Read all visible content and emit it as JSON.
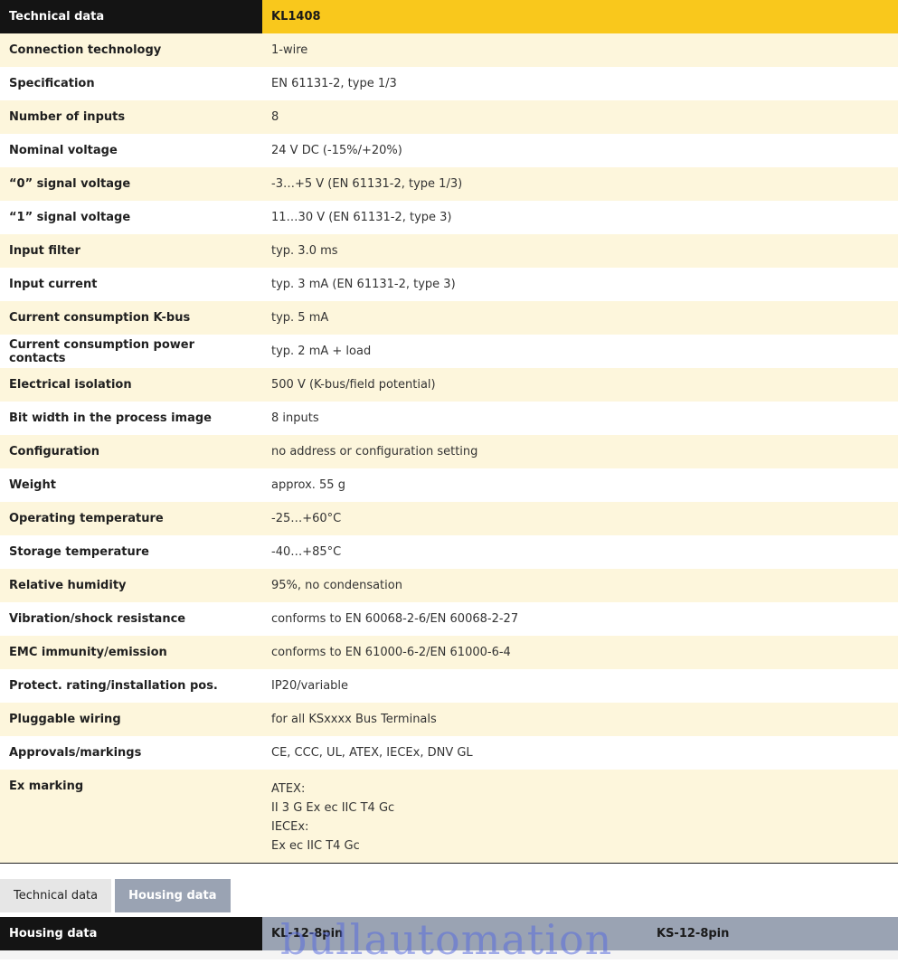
{
  "table": {
    "header_left": "Technical data",
    "header_right": "KL1408",
    "rows": [
      {
        "k": "Connection technology",
        "v": "1-wire"
      },
      {
        "k": "Specification",
        "v": "EN 61131-2, type 1/3"
      },
      {
        "k": "Number of inputs",
        "v": "8"
      },
      {
        "k": "Nominal voltage",
        "v": "24 V DC (-15%/+20%)"
      },
      {
        "k": "“0” signal voltage",
        "v": "-3…+5 V (EN 61131-2, type 1/3)"
      },
      {
        "k": "“1” signal voltage",
        "v": "11…30 V (EN 61131-2, type 3)"
      },
      {
        "k": "Input filter",
        "v": "typ. 3.0 ms"
      },
      {
        "k": "Input current",
        "v": "typ. 3 mA (EN 61131-2, type 3)"
      },
      {
        "k": "Current consumption K-bus",
        "v": "typ. 5 mA"
      },
      {
        "k": "Current consumption power contacts",
        "v": "typ. 2 mA + load"
      },
      {
        "k": "Electrical isolation",
        "v": "500 V (K-bus/field potential)"
      },
      {
        "k": "Bit width in the process image",
        "v": "8 inputs"
      },
      {
        "k": "Configuration",
        "v": "no address or configuration setting"
      },
      {
        "k": "Weight",
        "v": "approx. 55 g"
      },
      {
        "k": "Operating temperature",
        "v": "-25…+60°C"
      },
      {
        "k": "Storage temperature",
        "v": "-40…+85°C"
      },
      {
        "k": "Relative humidity",
        "v": "95%, no condensation"
      },
      {
        "k": "Vibration/shock resistance",
        "v": "conforms to EN 60068-2-6/EN 60068-2-27"
      },
      {
        "k": "EMC immunity/emission",
        "v": "conforms to EN 61000-6-2/EN 61000-6-4"
      },
      {
        "k": "Protect. rating/installation pos.",
        "v": "IP20/variable"
      },
      {
        "k": "Pluggable wiring",
        "v": "for all KSxxxx Bus Terminals"
      },
      {
        "k": "Approvals/markings",
        "v": "CE, CCC, UL, ATEX, IECEx, DNV GL"
      }
    ],
    "ex_marking": {
      "k": "Ex marking",
      "lines": [
        "ATEX:",
        "II 3 G Ex ec IIC T4 Gc",
        "IECEx:",
        "Ex ec IIC T4 Gc"
      ]
    }
  },
  "tabs": {
    "technical": "Technical data",
    "housing": "Housing data"
  },
  "housing": {
    "label": "Housing data",
    "col1": "KL-12-8pin",
    "col2": "KS-12-8pin"
  },
  "watermark": "bullautomation",
  "colors": {
    "header_dark": "#141414",
    "header_yellow": "#f9c81c",
    "row_tint": "#fdf6dc",
    "tab_active": "#9aa3b3"
  }
}
